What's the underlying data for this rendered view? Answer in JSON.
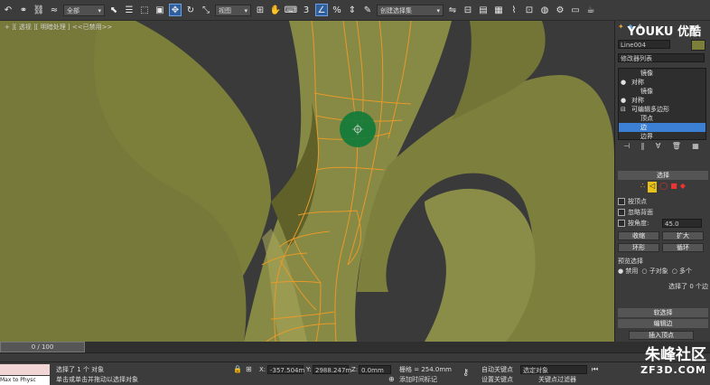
{
  "toolbar": {
    "filter_value": "全部",
    "view_value": "视图",
    "named_selection": "创建选择集"
  },
  "viewport": {
    "label": "+ ][ 透视 ][ 明暗处理 ] <<已禁用>>"
  },
  "panel": {
    "object_name": "Line004",
    "modifier_list": "修改器列表",
    "stack": [
      {
        "label": "镜像",
        "level": 1
      },
      {
        "label": "对称",
        "level": 0
      },
      {
        "label": "镜像",
        "level": 1
      },
      {
        "label": "对称",
        "level": 0
      },
      {
        "label": "可编辑多边形",
        "level": 0
      },
      {
        "label": "顶点",
        "level": 1
      },
      {
        "label": "边",
        "level": 1
      },
      {
        "label": "边界",
        "level": 1
      }
    ],
    "selection_title": "选择",
    "by_vertex": "按顶点",
    "ignore_backfacing": "忽略背面",
    "by_angle": "按角度:",
    "angle_value": "45.0",
    "shrink": "收缩",
    "grow": "扩大",
    "ring": "环形",
    "loop": "循环",
    "preview_selection": "预览选择",
    "preview_options": [
      "禁用",
      "子对象",
      "多个"
    ],
    "selected_count": "选择了 0 个边",
    "soft_selection": "软选择",
    "edit_edges": "编辑边",
    "insert_vertex": "插入顶点"
  },
  "timeline": {
    "frame_label": "0 / 100"
  },
  "status": {
    "maxscript": "Max to Physc",
    "selection_text": "选择了 1 个 对象",
    "prompt_text": "单击或单击并拖动以选择对象",
    "x_label": "X:",
    "x_value": "-357.504m",
    "y_label": "Y:",
    "y_value": "2988.247m",
    "z_label": "Z:",
    "z_value": "0.0mm",
    "grid": "栅格 = 254.0mm",
    "add_time_tag": "添加时间标记",
    "auto_key": "自动关键点",
    "selected_object": "选定对象",
    "set_key": "设置关键点",
    "key_filters": "关键点过滤器"
  },
  "watermarks": {
    "youku": "YOUKU 优酷",
    "site_name": "朱峰社区",
    "site_url": "ZF3D.COM"
  },
  "colors": {
    "model": "#7c7f3a",
    "model_light": "#a6a55a",
    "edges": "#e89a2a",
    "selection_brush": "#0f7a3a",
    "selected_stack_item": "#3b80d4",
    "background": "#3a3a3a"
  }
}
